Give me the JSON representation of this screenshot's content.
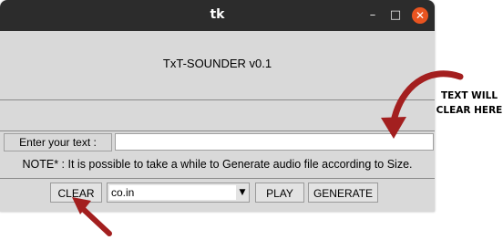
{
  "window": {
    "title": "tk",
    "controls": {
      "minimize": "–",
      "maximize": "□",
      "close": "✕"
    }
  },
  "app": {
    "heading": "TxT-SOUNDER v0.1",
    "input_label": "Enter your text :",
    "input_value": "",
    "note": "NOTE* : It is possible to take a while to Generate audio file according to Size."
  },
  "controls": {
    "clear_label": "CLEAR",
    "domain_value": "co.in",
    "play_label": "PLAY",
    "generate_label": "GENERATE"
  },
  "annotation": {
    "line1": "TEXT WILL",
    "line2": "CLEAR HERE",
    "arrow_color": "#a31f1f"
  }
}
